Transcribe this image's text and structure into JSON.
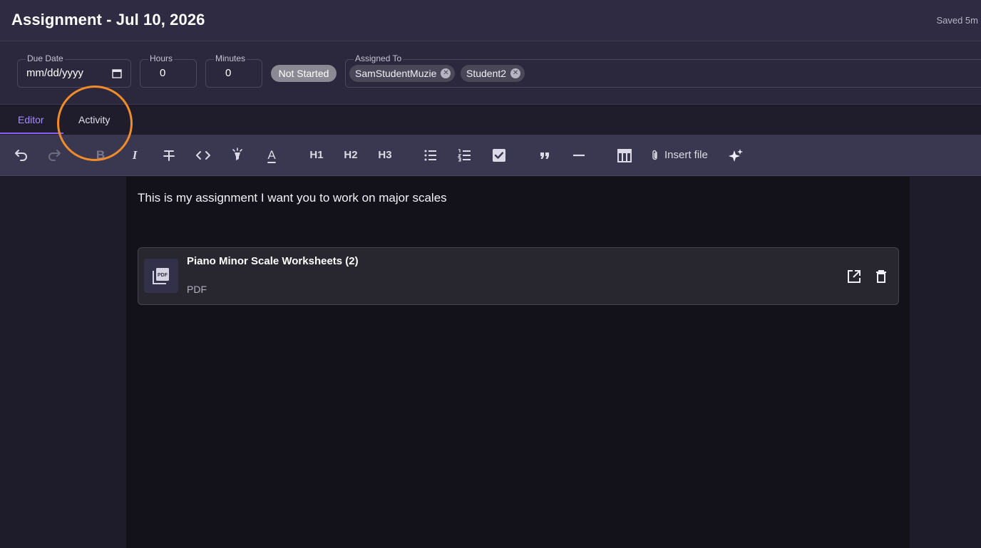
{
  "header": {
    "title": "Assignment - Jul 10, 2026",
    "saved_status": "Saved 5m"
  },
  "fields": {
    "due_date": {
      "label": "Due Date",
      "value": "mm/dd/yyyy"
    },
    "hours": {
      "label": "Hours",
      "value": "0"
    },
    "minutes": {
      "label": "Minutes",
      "value": "0"
    },
    "status": "Not Started",
    "assigned_to": {
      "label": "Assigned To",
      "chips": [
        "SamStudentMuzie",
        "Student2"
      ]
    }
  },
  "tabs": [
    {
      "label": "Editor",
      "active": true
    },
    {
      "label": "Activity",
      "active": false
    }
  ],
  "toolbar": {
    "icons": [
      "undo-icon",
      "redo-icon",
      "bold-icon",
      "italic-icon",
      "strikethrough-icon",
      "code-icon",
      "highlight-icon",
      "text-color-icon",
      "bullet-list-icon",
      "ordered-list-icon",
      "checkbox-icon",
      "quote-icon",
      "horizontal-rule-icon",
      "table-icon",
      "paperclip-icon",
      "sparkle-icon"
    ],
    "bold_label": "B",
    "italic_label": "I",
    "text_color_label": "A",
    "h1": "H1",
    "h2": "H2",
    "h3": "H3",
    "insert_file": "Insert file"
  },
  "editor": {
    "content": "This is my assignment I want you to work on major scales",
    "attachment": {
      "name": "Piano Minor Scale Worksheets (2)",
      "type": "PDF",
      "thumb_label": "PDF"
    }
  },
  "colors": {
    "accent": "#8b5cf6",
    "highlight_ring": "#f28c2a",
    "status_pill": "#8b8a94"
  }
}
